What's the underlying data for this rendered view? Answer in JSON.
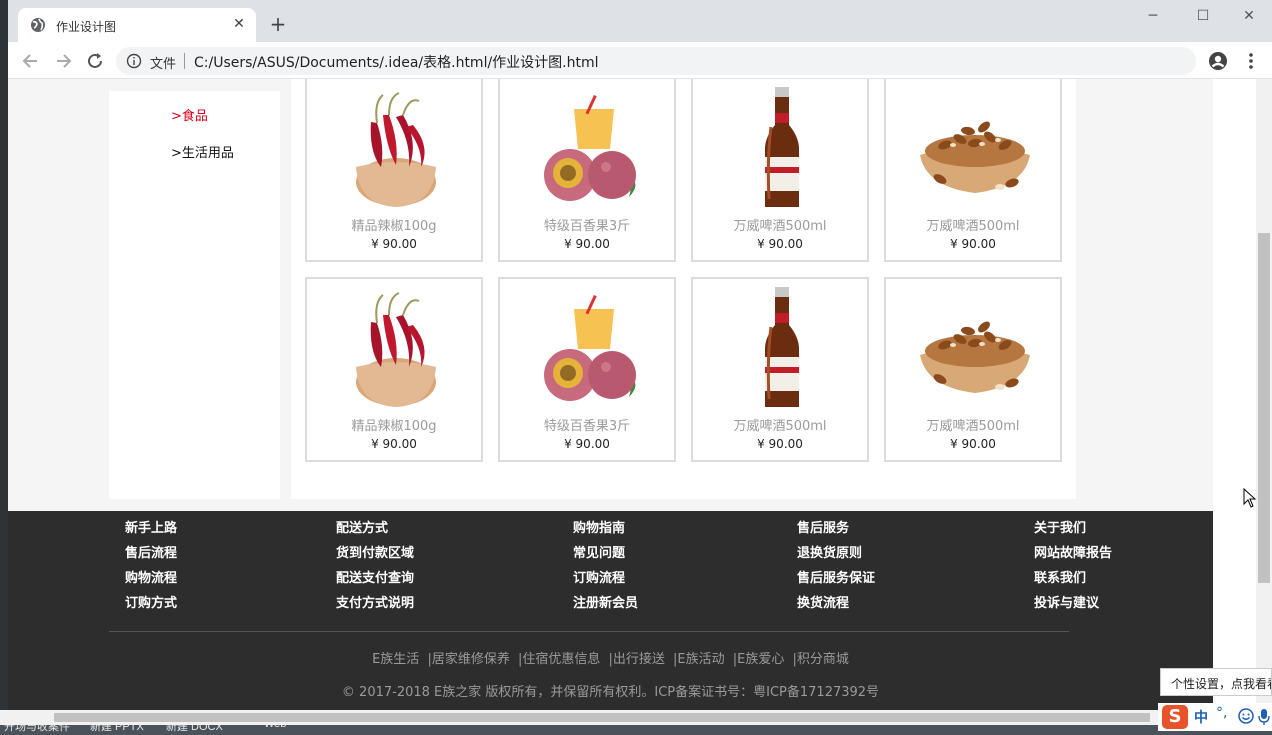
{
  "browser": {
    "tab_title": "作业设计图",
    "file_label": "文件",
    "url": "C:/Users/ASUS/Documents/.idea/表格.html/作业设计图.html",
    "window_controls": [
      "─",
      "☐",
      "✕"
    ]
  },
  "sidebar": {
    "categories": [
      {
        "label": ">食品",
        "active": true
      },
      {
        "label": ">生活用品",
        "active": false
      }
    ],
    "active_color": "#d9001b"
  },
  "products": [
    {
      "name": "精品辣椒100g",
      "price": "¥ 90.00",
      "icon": "chili-pepper-bowl-image"
    },
    {
      "name": "特级百香果3斤",
      "price": "¥ 90.00",
      "icon": "passion-fruit-image"
    },
    {
      "name": "万威啤酒500ml",
      "price": "¥ 90.00",
      "icon": "beer-bottle-image"
    },
    {
      "name": "万威啤酒500ml",
      "price": "¥ 90.00",
      "icon": "pine-nuts-bowl-image"
    },
    {
      "name": "精品辣椒100g",
      "price": "¥ 90.00",
      "icon": "chili-pepper-bowl-image"
    },
    {
      "name": "特级百香果3斤",
      "price": "¥ 90.00",
      "icon": "passion-fruit-image"
    },
    {
      "name": "万威啤酒500ml",
      "price": "¥ 90.00",
      "icon": "beer-bottle-image"
    },
    {
      "name": "万威啤酒500ml",
      "price": "¥ 90.00",
      "icon": "pine-nuts-bowl-image"
    }
  ],
  "footer": {
    "columns": [
      [
        "新手上路",
        "售后流程",
        "购物流程",
        "订购方式"
      ],
      [
        "配送方式",
        "货到付款区域",
        "配送支付查询",
        "支付方式说明"
      ],
      [
        "购物指南",
        "常见问题",
        "订购流程",
        "注册新会员"
      ],
      [
        "售后服务",
        "退换货原则",
        "售后服务保证",
        "换货流程"
      ],
      [
        "关于我们",
        "网站故障报告",
        "联系我们",
        "投诉与建议"
      ]
    ],
    "links": [
      "E族生活",
      "|居家维修保养",
      "|住宿优惠信息",
      "|出行接送",
      "|E族活动",
      "|E族爱心",
      "|积分商城"
    ],
    "copyright": "© 2017-2018 E族之家 版权所有，并保留所有权利。ICP备案证书号：粤ICP备17127392号",
    "background": "#2d2d2d"
  },
  "ime": {
    "tooltip": "个性设置，点我看看",
    "mode": "中",
    "punct": "°,"
  },
  "desktop": {
    "taskbar_items": [
      "开场与收案件",
      "新建 PPTX",
      "新建 DOCX",
      "Web-"
    ]
  }
}
